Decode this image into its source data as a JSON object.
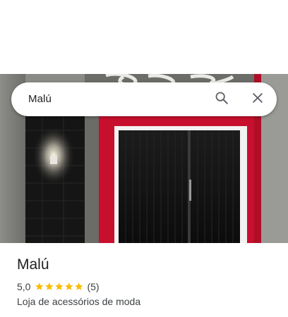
{
  "search": {
    "query": "Malú"
  },
  "place": {
    "name": "Malú",
    "rating": "5,0",
    "rating_value": 5,
    "rating_max": 5,
    "reviews": "(5)",
    "category": "Loja de acessórios de moda"
  },
  "colors": {
    "star": "#fbbc04",
    "text_primary": "#202124",
    "text_secondary": "#3c4043",
    "storefront_red": "#c8102e"
  },
  "icons": {
    "search": "search-icon",
    "close": "close-icon",
    "star": "star-icon"
  }
}
